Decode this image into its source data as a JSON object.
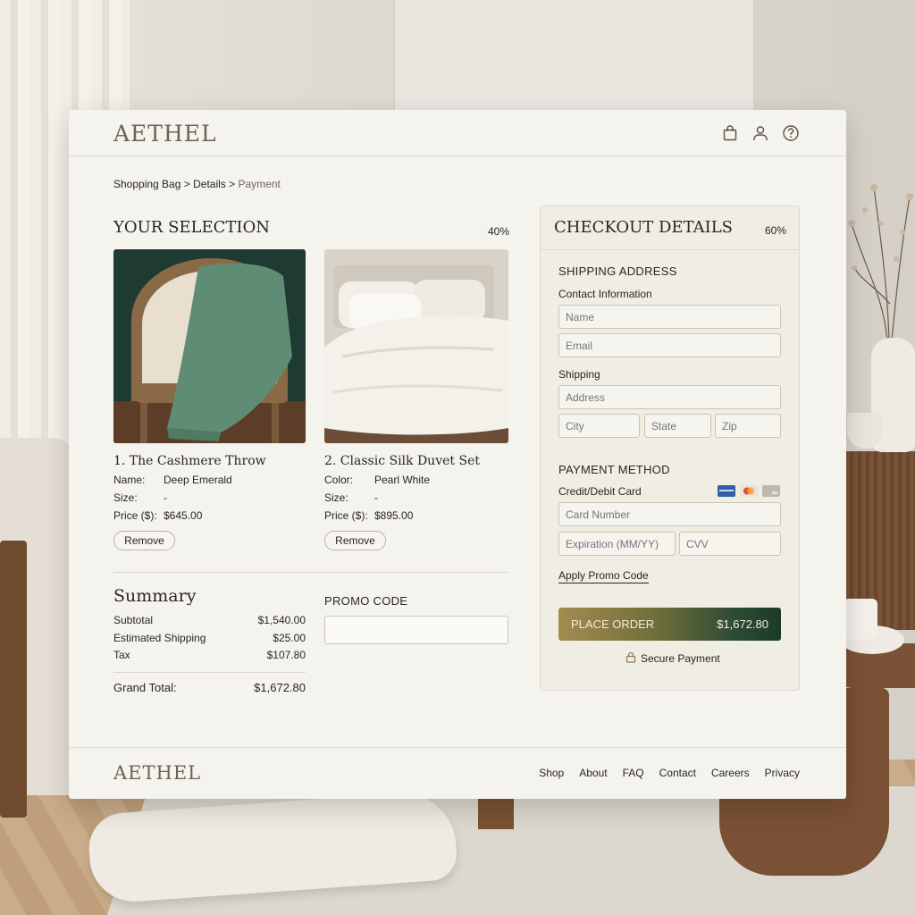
{
  "brand": {
    "name": "AETHEL"
  },
  "header_icons": [
    "shopping-bag-icon",
    "user-icon",
    "help-icon"
  ],
  "breadcrumb": {
    "step1": "Shopping Bag",
    "sep": ">",
    "step2": "Details",
    "step3": "Payment"
  },
  "selection": {
    "title": "YOUR SELECTION",
    "percent": "40%",
    "items": [
      {
        "name": "1. The Cashmere Throw",
        "attr1_label": "Name:",
        "attr1_value": "Deep Emerald",
        "size_label": "Size:",
        "size_value": "-",
        "price_label": "Price ($):",
        "price_value": "$645.00",
        "remove": "Remove"
      },
      {
        "name": "2. Classic Silk Duvet Set",
        "attr1_label": "Color:",
        "attr1_value": "Pearl White",
        "size_label": "Size:",
        "size_value": "-",
        "price_label": "Price ($):",
        "price_value": "$895.00",
        "remove": "Remove"
      }
    ]
  },
  "summary": {
    "title": "Summary",
    "subtotal_label": "Subtotal",
    "subtotal": "$1,540.00",
    "shipping_label": "Estimated Shipping",
    "shipping": "$25.00",
    "tax_label": "Tax",
    "tax": "$107.80",
    "total_label": "Grand Total:",
    "total": "$1,672.80"
  },
  "promo": {
    "label": "PROMO CODE",
    "placeholder": ""
  },
  "checkout": {
    "title": "CHECKOUT DETAILS",
    "percent": "60%",
    "shipping_title": "SHIPPING ADDRESS",
    "contact_label": "Contact Information",
    "name_placeholder": "Name",
    "email_placeholder": "Email",
    "shipping_label": "Shipping",
    "address_placeholder": "Address",
    "city_placeholder": "City",
    "state_placeholder": "State",
    "zip_placeholder": "Zip",
    "payment_title": "PAYMENT METHOD",
    "card_label": "Credit/Debit Card",
    "card_icons": [
      "visa-card-icon",
      "mastercard-icon",
      "generic-card-icon"
    ],
    "card_number_placeholder": "Card Number",
    "expiration_placeholder": "Expiration (MM/YY)",
    "cvv_placeholder": "CVV",
    "promo_link": "Apply Promo Code",
    "place_order_label": "PLACE ORDER",
    "place_order_amount": "$1,672.80",
    "secure_text": "Secure Payment"
  },
  "footer": {
    "links": [
      "Shop",
      "About",
      "FAQ",
      "Contact",
      "Careers",
      "Privacy"
    ]
  },
  "colors": {
    "accent_gold": "#a48c4f",
    "accent_green": "#1d3a29",
    "panel": "#f5f3ed"
  }
}
